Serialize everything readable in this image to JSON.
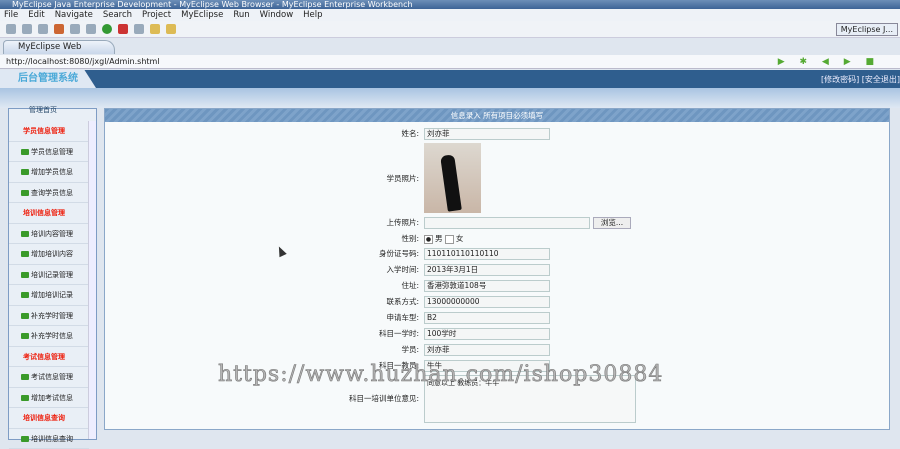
{
  "window": {
    "title": "MyEclipse Java Enterprise Development - MyEclipse Web Browser - MyEclipse Enterprise Workbench"
  },
  "menu": [
    "File",
    "Edit",
    "Navigate",
    "Search",
    "Project",
    "MyEclipse",
    "Run",
    "Window",
    "Help"
  ],
  "perspective": "MyEclipse J...",
  "tab": "MyEclipse Web Browser",
  "url": "http://localhost:8080/jxgl/Admin.shtml",
  "banner": {
    "logo": "后台管理系统",
    "links": "[修改密码] [安全退出]"
  },
  "sidebar": {
    "home": "管理首页",
    "items": [
      {
        "label": "学员信息管理",
        "header": true
      },
      {
        "label": "学员信息管理"
      },
      {
        "label": "增加学员信息"
      },
      {
        "label": "查询学员信息"
      },
      {
        "label": "培训信息管理",
        "header": true
      },
      {
        "label": "培训内容管理"
      },
      {
        "label": "增加培训内容"
      },
      {
        "label": "培训记录管理"
      },
      {
        "label": "增加培训记录"
      },
      {
        "label": "补充学时管理"
      },
      {
        "label": "补充学时信息"
      },
      {
        "label": "考试信息管理",
        "header": true
      },
      {
        "label": "考试信息管理"
      },
      {
        "label": "增加考试信息"
      },
      {
        "label": "培训信息查询",
        "header": true
      },
      {
        "label": "培训信息查询"
      }
    ]
  },
  "form": {
    "header": "信息录入 所有项目必须填写",
    "name": {
      "label": "姓名:",
      "value": "刘亦菲"
    },
    "photo": {
      "label": "学员照片:"
    },
    "upload": {
      "label": "上传照片:",
      "button": "浏览..."
    },
    "gender": {
      "label": "性别:",
      "male": "男",
      "female": "女"
    },
    "fields": [
      {
        "label": "身份证号码:",
        "value": "110110110110110"
      },
      {
        "label": "入学时间:",
        "value": "2013年3月1日"
      },
      {
        "label": "住址:",
        "value": "香港弥敦道108号"
      },
      {
        "label": "联系方式:",
        "value": "13000000000"
      },
      {
        "label": "申请车型:",
        "value": "B2"
      },
      {
        "label": "科目一学时:",
        "value": "100学时"
      },
      {
        "label": "学员:",
        "value": "刘亦菲"
      },
      {
        "label": "科目一教员:",
        "value": "牛牛"
      }
    ],
    "opinion": {
      "label": "科目一培训单位意见:",
      "value": "同意以上 教练员：牛牛"
    }
  },
  "watermark": "https://www.huzhan.com/ishop30884"
}
